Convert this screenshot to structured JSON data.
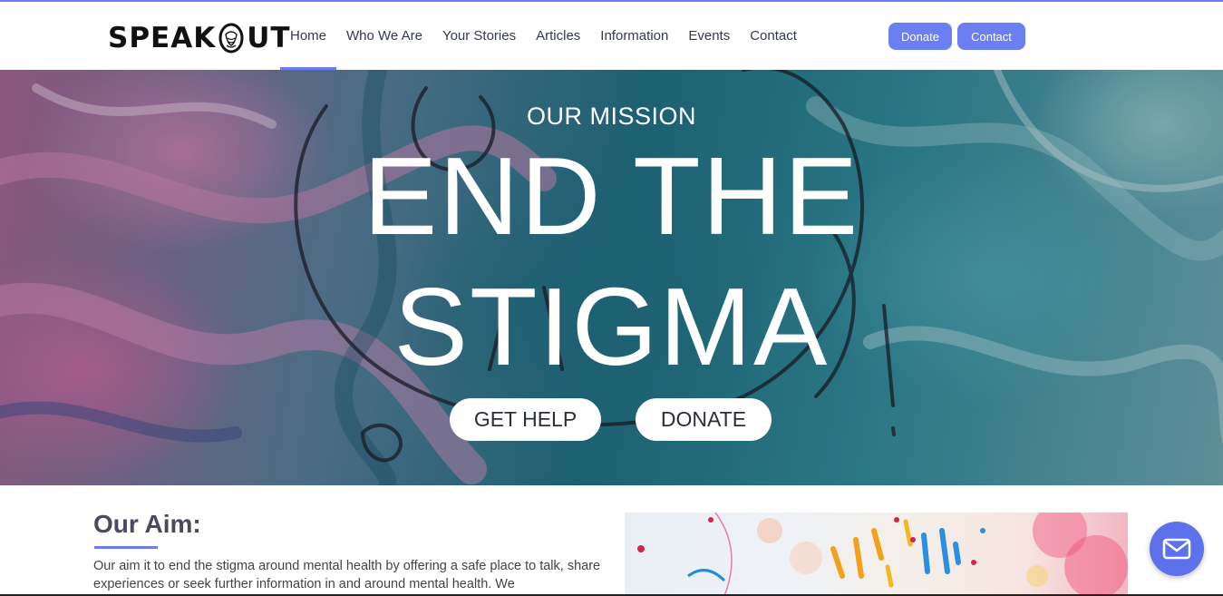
{
  "header": {
    "logo_text_left": "SPEAK",
    "logo_text_right": "UT",
    "nav": [
      {
        "label": "Home",
        "active": true
      },
      {
        "label": "Who We Are"
      },
      {
        "label": "Your Stories"
      },
      {
        "label": "Articles"
      },
      {
        "label": "Information"
      },
      {
        "label": "Events"
      },
      {
        "label": "Contact"
      }
    ],
    "donate_label": "Donate",
    "contact_label": "Contact"
  },
  "hero": {
    "subtitle": "OUR MISSION",
    "title_line1": "END THE",
    "title_line2": "STIGMA",
    "get_help_label": "GET HELP",
    "donate_label": "DONATE"
  },
  "aim": {
    "title": "Our Aim:",
    "text": " Our aim it to end the stigma around mental health by offering a safe place to talk, share experiences or seek further information in and around mental health. We"
  },
  "chat": {
    "icon": "mail-icon"
  },
  "colors": {
    "accent": "#6b7cf0",
    "button": "#6b7ef2",
    "chat": "#5d72ea"
  }
}
